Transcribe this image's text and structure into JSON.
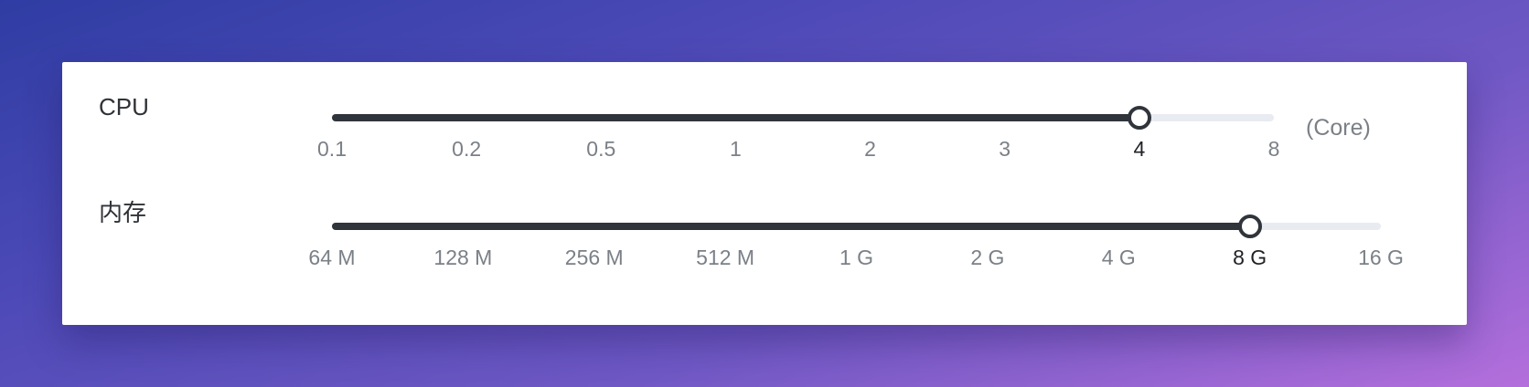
{
  "cpu": {
    "label": "CPU",
    "marks": [
      "0.1",
      "0.2",
      "0.5",
      "1",
      "2",
      "3",
      "4",
      "8"
    ],
    "selected_index": 6,
    "unit": "(Core)"
  },
  "memory": {
    "label": "内存",
    "marks": [
      "64 M",
      "128 M",
      "256 M",
      "512 M",
      "1 G",
      "2 G",
      "4 G",
      "8 G",
      "16 G"
    ],
    "selected_index": 7
  },
  "colors": {
    "track": "#30343b",
    "rail": "#e8ebf0",
    "mark": "#7b8087",
    "mark_active": "#1f2226"
  }
}
